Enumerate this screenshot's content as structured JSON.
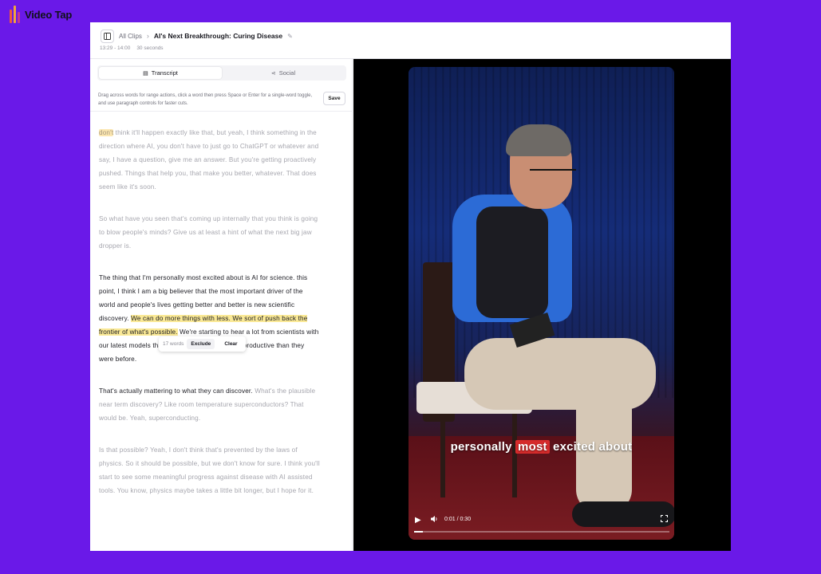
{
  "brand": {
    "name": "Video Tap"
  },
  "header": {
    "breadcrumb_root": "All Clips",
    "separator": "›",
    "title": "AI's Next Breakthrough: Curing Disease",
    "time_range": "13:29 - 14:00",
    "duration": "30 seconds"
  },
  "tabs": [
    {
      "label": "Transcript",
      "icon": "transcript-icon",
      "active": true
    },
    {
      "label": "Social",
      "icon": "share-icon",
      "active": false
    }
  ],
  "help_text": "Drag across words for range actions, click a word then press Space or Enter for a single-word toggle, and use paragraph controls for faster cuts.",
  "save_label": "Save",
  "transcript": {
    "p1_first": "don't",
    "p1_rest": " think it'll happen exactly like that, but yeah, I think something in the direction where AI, you don't have to just go to ChatGPT or whatever and say, I have a question, give me an answer. But you're getting proactively pushed. Things that help you, that make you better, whatever. That does seem like it's soon.",
    "p2": "So what have you seen that's coming up internally that you think is going to blow people's minds? Give us at least a hint of what the next big jaw dropper is.",
    "p3_a": "The thing that I'm personally most excited about is AI for science. this point, I think I am a big believer that the most important driver of the world and people's lives getting better and better is new scientific discovery. ",
    "p3_hl": "We can do more things with less. We sort of push back the frontier of what's possible.",
    "p3_b": " We're starting to hear a lot from scientists with our latest models that they're actually just more productive than they were before.",
    "p4_a": "That's actually mattering to what they can discover.",
    "p4_b": " What's the plausible near term discovery? Like room temperature superconductors? That would be. Yeah, superconducting.",
    "p5": "Is that possible? Yeah, I don't think that's prevented by the laws of physics. So it should be possible, but we don't know for sure. I think you'll start to see some meaningful progress against disease with AI assisted tools. You know, physics maybe takes a little bit longer, but I hope for it."
  },
  "selection_popover": {
    "count": "17 words",
    "exclude_label": "Exclude",
    "clear_label": "Clear"
  },
  "video": {
    "caption_before": "personally ",
    "caption_hot": "most",
    "caption_after": " excited about",
    "time": "0:01 / 0:30",
    "progress": 0.033
  },
  "colors": {
    "background": "#6a19e8",
    "highlight": "#fae996",
    "caption_highlight": "#d62b2b"
  }
}
